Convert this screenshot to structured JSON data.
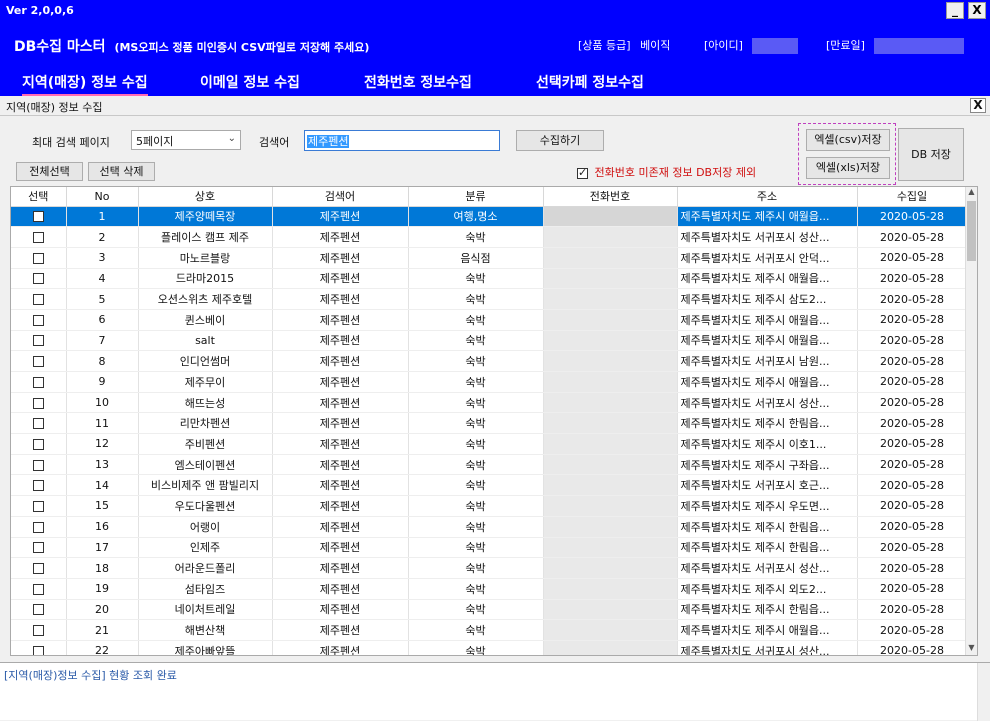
{
  "window": {
    "version": "Ver 2,0,0,6",
    "minimize": "_",
    "close": "X"
  },
  "header": {
    "title": "DB수집 마스터",
    "subtitle": "(MS오피스 정품 미인증시 CSV파일로 저장해 주세요)",
    "grade_label": "[상품 등급]",
    "grade_value": "베이직",
    "id_label": "[아이디]",
    "expire_label": "[만료일]"
  },
  "menu": {
    "items": [
      {
        "label": "지역(매장) 정보 수집"
      },
      {
        "label": "이메일 정보 수집"
      },
      {
        "label": "전화번호 정보수집"
      },
      {
        "label": "선택카페 정보수집"
      }
    ]
  },
  "panel": {
    "title": "지역(매장) 정보 수집",
    "close": "X"
  },
  "controls": {
    "max_page_label": "최대 검색 페이지",
    "max_page_value": "5페이지",
    "keyword_label": "검색어",
    "keyword_value": "제주펜션",
    "collect_button": "수집하기",
    "select_all_button": "전체선택",
    "delete_selected_button": "선택 삭제",
    "exclude_no_phone_label": "전화번호 미존재 정보 DB저장 제외",
    "excel_csv_button": "엑셀(csv)저장",
    "excel_xls_button": "엑셀(xls)저장",
    "db_save_button": "DB 저장"
  },
  "table": {
    "headers": [
      "선택",
      "No",
      "상호",
      "검색어",
      "분류",
      "전화번호",
      "주소",
      "수집일"
    ],
    "rows": [
      {
        "no": "1",
        "name": "제주양떼목장",
        "keyword": "제주펜션",
        "category": "여행,명소",
        "phone": "",
        "address": "제주특별자치도 제주시 애월읍...",
        "date": "2020-05-28"
      },
      {
        "no": "2",
        "name": "플레이스 캠프 제주",
        "keyword": "제주펜션",
        "category": "숙박",
        "phone": "",
        "address": "제주특별자치도 서귀포시 성산...",
        "date": "2020-05-28"
      },
      {
        "no": "3",
        "name": "마노르블랑",
        "keyword": "제주펜션",
        "category": "음식점",
        "phone": "",
        "address": "제주특별자치도 서귀포시 안덕...",
        "date": "2020-05-28"
      },
      {
        "no": "4",
        "name": "드라마2015",
        "keyword": "제주펜션",
        "category": "숙박",
        "phone": "",
        "address": "제주특별자치도 제주시 애월읍...",
        "date": "2020-05-28"
      },
      {
        "no": "5",
        "name": "오션스위츠 제주호텔",
        "keyword": "제주펜션",
        "category": "숙박",
        "phone": "",
        "address": "제주특별자치도 제주시 삼도2...",
        "date": "2020-05-28"
      },
      {
        "no": "6",
        "name": "퀸스베이",
        "keyword": "제주펜션",
        "category": "숙박",
        "phone": "",
        "address": "제주특별자치도 제주시 애월읍...",
        "date": "2020-05-28"
      },
      {
        "no": "7",
        "name": "salt",
        "keyword": "제주펜션",
        "category": "숙박",
        "phone": "",
        "address": "제주특별자치도 제주시 애월읍...",
        "date": "2020-05-28"
      },
      {
        "no": "8",
        "name": "인디언썸머",
        "keyword": "제주펜션",
        "category": "숙박",
        "phone": "",
        "address": "제주특별자치도 서귀포시 남원...",
        "date": "2020-05-28"
      },
      {
        "no": "9",
        "name": "제주무이",
        "keyword": "제주펜션",
        "category": "숙박",
        "phone": "",
        "address": "제주특별자치도 제주시 애월읍...",
        "date": "2020-05-28"
      },
      {
        "no": "10",
        "name": "해뜨는성",
        "keyword": "제주펜션",
        "category": "숙박",
        "phone": "",
        "address": "제주특별자치도 서귀포시 성산...",
        "date": "2020-05-28"
      },
      {
        "no": "11",
        "name": "리만차펜션",
        "keyword": "제주펜션",
        "category": "숙박",
        "phone": "",
        "address": "제주특별자치도 제주시 한림읍...",
        "date": "2020-05-28"
      },
      {
        "no": "12",
        "name": "주비펜션",
        "keyword": "제주펜션",
        "category": "숙박",
        "phone": "",
        "address": "제주특별자치도 제주시 이호1...",
        "date": "2020-05-28"
      },
      {
        "no": "13",
        "name": "엠스테이펜션",
        "keyword": "제주펜션",
        "category": "숙박",
        "phone": "",
        "address": "제주특별자치도 제주시 구좌읍...",
        "date": "2020-05-28"
      },
      {
        "no": "14",
        "name": "비스비제주 앤 팜빌리지",
        "keyword": "제주펜션",
        "category": "숙박",
        "phone": "",
        "address": "제주특별자치도 서귀포시 호근...",
        "date": "2020-05-28"
      },
      {
        "no": "15",
        "name": "우도다울펜션",
        "keyword": "제주펜션",
        "category": "숙박",
        "phone": "",
        "address": "제주특별자치도 제주시 우도면...",
        "date": "2020-05-28"
      },
      {
        "no": "16",
        "name": "어랭이",
        "keyword": "제주펜션",
        "category": "숙박",
        "phone": "",
        "address": "제주특별자치도 제주시 한림읍...",
        "date": "2020-05-28"
      },
      {
        "no": "17",
        "name": "인제주",
        "keyword": "제주펜션",
        "category": "숙박",
        "phone": "",
        "address": "제주특별자치도 제주시 한림읍...",
        "date": "2020-05-28"
      },
      {
        "no": "18",
        "name": "어라운드폴리",
        "keyword": "제주펜션",
        "category": "숙박",
        "phone": "",
        "address": "제주특별자치도 서귀포시 성산...",
        "date": "2020-05-28"
      },
      {
        "no": "19",
        "name": "섬타임즈",
        "keyword": "제주펜션",
        "category": "숙박",
        "phone": "",
        "address": "제주특별자치도 제주시 외도2...",
        "date": "2020-05-28"
      },
      {
        "no": "20",
        "name": "네이처트레일",
        "keyword": "제주펜션",
        "category": "숙박",
        "phone": "",
        "address": "제주특별자치도 제주시 한림읍...",
        "date": "2020-05-28"
      },
      {
        "no": "21",
        "name": "해변산책",
        "keyword": "제주펜션",
        "category": "숙박",
        "phone": "",
        "address": "제주특별자치도 제주시 애월읍...",
        "date": "2020-05-28"
      },
      {
        "no": "22",
        "name": "제주아빠앞뜰",
        "keyword": "제주펜션",
        "category": "숙박",
        "phone": "",
        "address": "제주특별자치도 서귀포시 성산...",
        "date": "2020-05-28"
      }
    ]
  },
  "log": {
    "message": "[지역(매장)정보 수집] 현황 조회 완료"
  }
}
